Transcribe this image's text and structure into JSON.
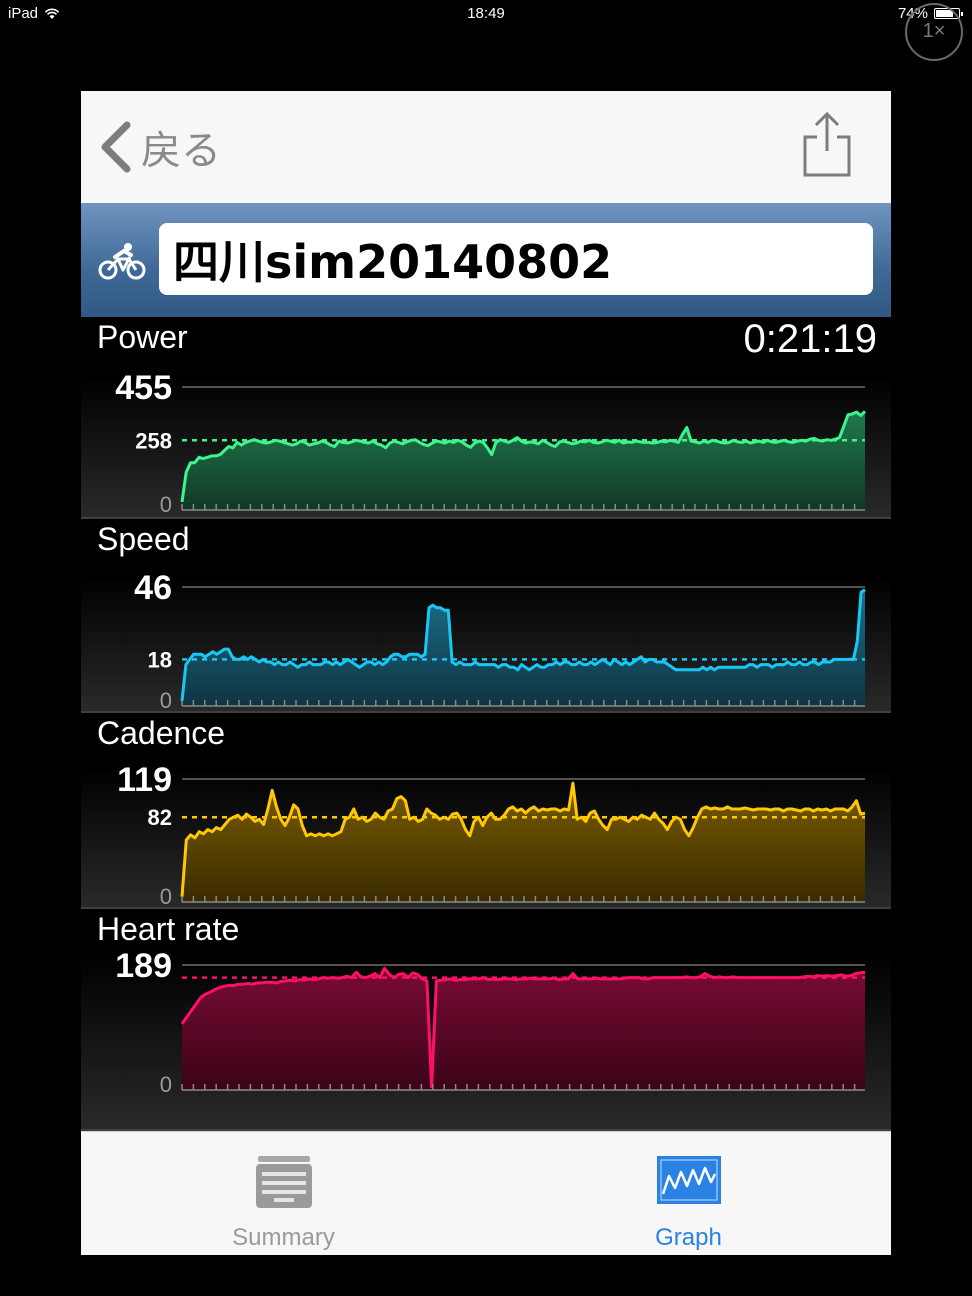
{
  "status_bar": {
    "device": "iPad",
    "time": "18:49",
    "battery": "74%",
    "zoom": "1×"
  },
  "nav": {
    "back_label": "戻る"
  },
  "activity": {
    "title": "四川sim20140802",
    "elapsed": "0:21:19"
  },
  "colors": {
    "power": "#3ef58c",
    "speed": "#19c7f5",
    "cadence": "#ffc800",
    "heart": "#ff0f6a",
    "tab_active": "#2a82e4",
    "tab_inactive": "#9a9a9a"
  },
  "charts": [
    {
      "title": "Power",
      "max_label": "455",
      "avg_label": "258",
      "zero_label": "0",
      "max": 455,
      "avg": 258,
      "color": "#3ef58c",
      "fill_top": "#1f7a4d",
      "fill_bottom": "#123826",
      "values": [
        30,
        140,
        175,
        175,
        195,
        190,
        195,
        200,
        200,
        205,
        220,
        235,
        230,
        250,
        240,
        250,
        255,
        260,
        255,
        250,
        248,
        252,
        258,
        255,
        250,
        245,
        240,
        245,
        255,
        250,
        240,
        245,
        248,
        255,
        250,
        240,
        235,
        255,
        250,
        248,
        252,
        258,
        255,
        250,
        248,
        255,
        245,
        240,
        230,
        248,
        255,
        250,
        245,
        252,
        258,
        260,
        250,
        242,
        238,
        248,
        255,
        252,
        248,
        255,
        250,
        258,
        252,
        240,
        232,
        248,
        255,
        250,
        230,
        205,
        250,
        260,
        255,
        250,
        258,
        268,
        255,
        248,
        252,
        250,
        245,
        258,
        250,
        240,
        235,
        252,
        255,
        250,
        245,
        248,
        255,
        252,
        258,
        250,
        248,
        252,
        258,
        255,
        250,
        258,
        248,
        252,
        250,
        255,
        252,
        250,
        250,
        248,
        250,
        255,
        252,
        258,
        255,
        250,
        280,
        305,
        255,
        252,
        248,
        255,
        250,
        258,
        255,
        250,
        248,
        250,
        258,
        252,
        250,
        255,
        248,
        252,
        255,
        250,
        258,
        252,
        250,
        255,
        258,
        252,
        250,
        255,
        258,
        255,
        262,
        265,
        258,
        255,
        260,
        258,
        262,
        268,
        310,
        352,
        355,
        362,
        350,
        365
      ]
    },
    {
      "title": "Speed",
      "max_label": "46",
      "avg_label": "18",
      "zero_label": "0",
      "max": 46,
      "avg": 18,
      "color": "#19c7f5",
      "fill_top": "#1b6e86",
      "fill_bottom": "#0f3442",
      "values": [
        2,
        16,
        18,
        20,
        20,
        20,
        19,
        20,
        21,
        20,
        21,
        22,
        22,
        19,
        18,
        18,
        19,
        18,
        19,
        18,
        17,
        18,
        17,
        17,
        16,
        17,
        16,
        16,
        17,
        16,
        15,
        16,
        16,
        17,
        16,
        16,
        16,
        17,
        17,
        16,
        17,
        16,
        17,
        18,
        17,
        16,
        15,
        16,
        17,
        17,
        16,
        17,
        16,
        17,
        19,
        20,
        20,
        19,
        19,
        20,
        20,
        20,
        19,
        20,
        38,
        39,
        38,
        38,
        37,
        37,
        17,
        16,
        17,
        16,
        16,
        16,
        17,
        16,
        16,
        16,
        16,
        16,
        15,
        16,
        16,
        15,
        15,
        14,
        16,
        15,
        14,
        15,
        16,
        15,
        15,
        16,
        16,
        17,
        16,
        17,
        17,
        16,
        16,
        17,
        16,
        16,
        17,
        16,
        17,
        18,
        17,
        16,
        18,
        17,
        16,
        17,
        16,
        17,
        18,
        19,
        17,
        18,
        18,
        17,
        17,
        17,
        16,
        15,
        14,
        14,
        14,
        14,
        14,
        14,
        14,
        15,
        14,
        15,
        14,
        15,
        15,
        15,
        15,
        15,
        15,
        15,
        15,
        16,
        16,
        15,
        16,
        16,
        16,
        15,
        16,
        16,
        16,
        17,
        16,
        16,
        17,
        16,
        16,
        17,
        17,
        16,
        17,
        17,
        17,
        18,
        18,
        18,
        18,
        18,
        18,
        25,
        44,
        45
      ]
    },
    {
      "title": "Cadence",
      "max_label": "119",
      "avg_label": "82",
      "zero_label": "0",
      "max": 119,
      "avg": 82,
      "color": "#ffc800",
      "fill_top": "#7a5c00",
      "fill_bottom": "#3a2c00",
      "values": [
        5,
        60,
        65,
        62,
        68,
        66,
        70,
        68,
        72,
        70,
        75,
        80,
        82,
        84,
        80,
        85,
        82,
        78,
        80,
        75,
        90,
        108,
        92,
        80,
        74,
        82,
        94,
        90,
        74,
        64,
        66,
        64,
        66,
        64,
        66,
        64,
        66,
        68,
        80,
        82,
        90,
        80,
        82,
        78,
        80,
        86,
        82,
        80,
        88,
        90,
        100,
        102,
        98,
        80,
        82,
        78,
        80,
        90,
        86,
        84,
        80,
        82,
        80,
        85,
        86,
        80,
        70,
        64,
        78,
        82,
        74,
        82,
        86,
        80,
        80,
        84,
        90,
        92,
        88,
        90,
        86,
        90,
        92,
        88,
        90,
        89,
        90,
        90,
        88,
        90,
        89,
        115,
        80,
        82,
        78,
        86,
        88,
        80,
        74,
        70,
        80,
        80,
        82,
        80,
        78,
        82,
        80,
        84,
        82,
        80,
        86,
        80,
        76,
        70,
        78,
        82,
        80,
        70,
        64,
        72,
        82,
        90,
        92,
        90,
        91,
        90,
        90,
        92,
        90,
        90,
        90,
        91,
        90,
        89,
        90,
        90,
        90,
        89,
        90,
        90,
        88,
        90,
        90,
        89,
        88,
        90,
        90,
        88,
        90,
        89,
        90,
        88,
        90,
        90,
        90,
        88,
        92,
        98,
        85,
        86
      ]
    },
    {
      "title": "Heart rate",
      "max_label": "189",
      "avg_label": "",
      "zero_label": "0",
      "max": 189,
      "avg": 170,
      "color": "#ff0f6a",
      "fill_top": "#7a0a34",
      "fill_bottom": "#3a0418",
      "values": [
        100,
        110,
        120,
        130,
        140,
        145,
        148,
        152,
        155,
        157,
        158,
        158,
        160,
        160,
        161,
        160,
        162,
        162,
        163,
        163,
        162,
        164,
        165,
        166,
        165,
        167,
        166,
        168,
        167,
        168,
        170,
        169,
        170,
        169,
        170,
        172,
        170,
        178,
        171,
        170,
        172,
        176,
        170,
        184,
        175,
        170,
        175,
        176,
        170,
        177,
        175,
        168,
        165,
        5,
        165,
        166,
        167,
        168,
        166,
        167,
        167,
        168,
        168,
        168,
        170,
        167,
        168,
        167,
        168,
        168,
        168,
        167,
        168,
        168,
        169,
        168,
        168,
        168,
        168,
        169,
        167,
        168,
        168,
        176,
        168,
        168,
        168,
        168,
        169,
        168,
        168,
        168,
        168,
        168,
        169,
        170,
        170,
        170,
        168,
        168,
        170,
        170,
        170,
        170,
        170,
        170,
        170,
        171,
        170,
        170,
        171,
        176,
        172,
        170,
        171,
        170,
        170,
        171,
        170,
        170,
        170,
        170,
        170,
        170,
        170,
        170,
        170,
        170,
        170,
        170,
        170,
        170,
        171,
        172,
        171,
        173,
        172,
        173,
        172,
        173,
        174,
        172,
        173,
        176,
        177,
        178
      ]
    }
  ],
  "tabs": [
    {
      "label": "Summary",
      "active": false,
      "icon": "summary-icon"
    },
    {
      "label": "Graph",
      "active": true,
      "icon": "graph-icon"
    }
  ]
}
